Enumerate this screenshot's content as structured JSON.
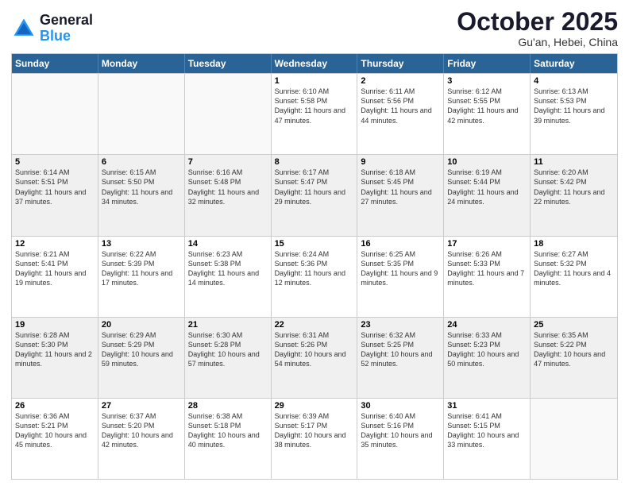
{
  "logo": {
    "line1": "General",
    "line2": "Blue"
  },
  "title": "October 2025",
  "subtitle": "Gu'an, Hebei, China",
  "weekdays": [
    "Sunday",
    "Monday",
    "Tuesday",
    "Wednesday",
    "Thursday",
    "Friday",
    "Saturday"
  ],
  "weeks": [
    [
      {
        "day": "",
        "info": ""
      },
      {
        "day": "",
        "info": ""
      },
      {
        "day": "",
        "info": ""
      },
      {
        "day": "1",
        "info": "Sunrise: 6:10 AM\nSunset: 5:58 PM\nDaylight: 11 hours and 47 minutes."
      },
      {
        "day": "2",
        "info": "Sunrise: 6:11 AM\nSunset: 5:56 PM\nDaylight: 11 hours and 44 minutes."
      },
      {
        "day": "3",
        "info": "Sunrise: 6:12 AM\nSunset: 5:55 PM\nDaylight: 11 hours and 42 minutes."
      },
      {
        "day": "4",
        "info": "Sunrise: 6:13 AM\nSunset: 5:53 PM\nDaylight: 11 hours and 39 minutes."
      }
    ],
    [
      {
        "day": "5",
        "info": "Sunrise: 6:14 AM\nSunset: 5:51 PM\nDaylight: 11 hours and 37 minutes."
      },
      {
        "day": "6",
        "info": "Sunrise: 6:15 AM\nSunset: 5:50 PM\nDaylight: 11 hours and 34 minutes."
      },
      {
        "day": "7",
        "info": "Sunrise: 6:16 AM\nSunset: 5:48 PM\nDaylight: 11 hours and 32 minutes."
      },
      {
        "day": "8",
        "info": "Sunrise: 6:17 AM\nSunset: 5:47 PM\nDaylight: 11 hours and 29 minutes."
      },
      {
        "day": "9",
        "info": "Sunrise: 6:18 AM\nSunset: 5:45 PM\nDaylight: 11 hours and 27 minutes."
      },
      {
        "day": "10",
        "info": "Sunrise: 6:19 AM\nSunset: 5:44 PM\nDaylight: 11 hours and 24 minutes."
      },
      {
        "day": "11",
        "info": "Sunrise: 6:20 AM\nSunset: 5:42 PM\nDaylight: 11 hours and 22 minutes."
      }
    ],
    [
      {
        "day": "12",
        "info": "Sunrise: 6:21 AM\nSunset: 5:41 PM\nDaylight: 11 hours and 19 minutes."
      },
      {
        "day": "13",
        "info": "Sunrise: 6:22 AM\nSunset: 5:39 PM\nDaylight: 11 hours and 17 minutes."
      },
      {
        "day": "14",
        "info": "Sunrise: 6:23 AM\nSunset: 5:38 PM\nDaylight: 11 hours and 14 minutes."
      },
      {
        "day": "15",
        "info": "Sunrise: 6:24 AM\nSunset: 5:36 PM\nDaylight: 11 hours and 12 minutes."
      },
      {
        "day": "16",
        "info": "Sunrise: 6:25 AM\nSunset: 5:35 PM\nDaylight: 11 hours and 9 minutes."
      },
      {
        "day": "17",
        "info": "Sunrise: 6:26 AM\nSunset: 5:33 PM\nDaylight: 11 hours and 7 minutes."
      },
      {
        "day": "18",
        "info": "Sunrise: 6:27 AM\nSunset: 5:32 PM\nDaylight: 11 hours and 4 minutes."
      }
    ],
    [
      {
        "day": "19",
        "info": "Sunrise: 6:28 AM\nSunset: 5:30 PM\nDaylight: 11 hours and 2 minutes."
      },
      {
        "day": "20",
        "info": "Sunrise: 6:29 AM\nSunset: 5:29 PM\nDaylight: 10 hours and 59 minutes."
      },
      {
        "day": "21",
        "info": "Sunrise: 6:30 AM\nSunset: 5:28 PM\nDaylight: 10 hours and 57 minutes."
      },
      {
        "day": "22",
        "info": "Sunrise: 6:31 AM\nSunset: 5:26 PM\nDaylight: 10 hours and 54 minutes."
      },
      {
        "day": "23",
        "info": "Sunrise: 6:32 AM\nSunset: 5:25 PM\nDaylight: 10 hours and 52 minutes."
      },
      {
        "day": "24",
        "info": "Sunrise: 6:33 AM\nSunset: 5:23 PM\nDaylight: 10 hours and 50 minutes."
      },
      {
        "day": "25",
        "info": "Sunrise: 6:35 AM\nSunset: 5:22 PM\nDaylight: 10 hours and 47 minutes."
      }
    ],
    [
      {
        "day": "26",
        "info": "Sunrise: 6:36 AM\nSunset: 5:21 PM\nDaylight: 10 hours and 45 minutes."
      },
      {
        "day": "27",
        "info": "Sunrise: 6:37 AM\nSunset: 5:20 PM\nDaylight: 10 hours and 42 minutes."
      },
      {
        "day": "28",
        "info": "Sunrise: 6:38 AM\nSunset: 5:18 PM\nDaylight: 10 hours and 40 minutes."
      },
      {
        "day": "29",
        "info": "Sunrise: 6:39 AM\nSunset: 5:17 PM\nDaylight: 10 hours and 38 minutes."
      },
      {
        "day": "30",
        "info": "Sunrise: 6:40 AM\nSunset: 5:16 PM\nDaylight: 10 hours and 35 minutes."
      },
      {
        "day": "31",
        "info": "Sunrise: 6:41 AM\nSunset: 5:15 PM\nDaylight: 10 hours and 33 minutes."
      },
      {
        "day": "",
        "info": ""
      }
    ]
  ]
}
